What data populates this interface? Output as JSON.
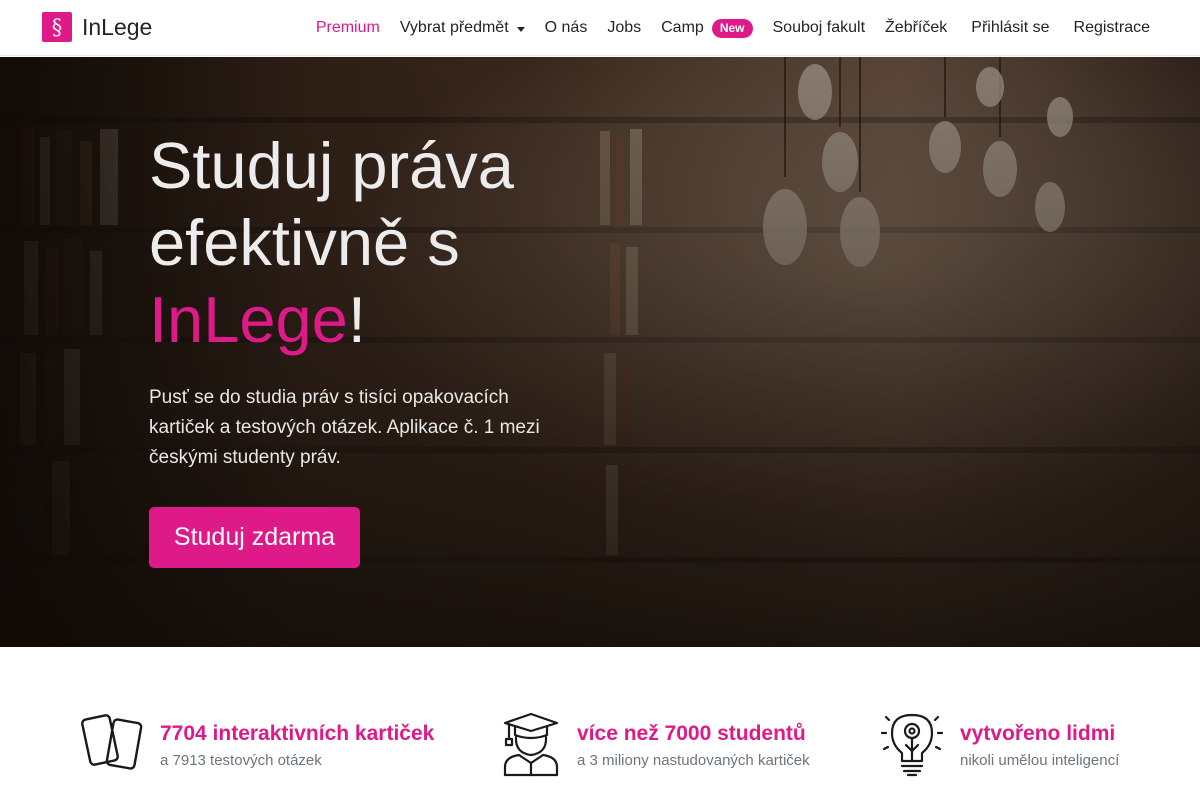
{
  "brand": {
    "logo_glyph": "§",
    "name": "InLege",
    "color": "#dd1a87"
  },
  "nav": {
    "premium": "Premium",
    "subject": "Vybrat předmět",
    "about": "O nás",
    "jobs": "Jobs",
    "camp": "Camp",
    "camp_badge": "New",
    "battle": "Souboj fakult",
    "ranking": "Žebříček",
    "login": "Přihlásit se",
    "register": "Registrace"
  },
  "hero": {
    "title_line1": "Studuj práva",
    "title_line2": "efektivně s",
    "title_brand": "InLege",
    "title_end": "!",
    "text": "Pusť se do studia práv s tisíci opakovacích kartiček a testových otázek. Aplikace č. 1 mezi českými studenty práv.",
    "cta": "Studuj zdarma",
    "background": "library-bookshelves-image"
  },
  "features": [
    {
      "icon": "flashcards-icon",
      "title": "7704 interaktivních kartiček",
      "sub": "a 7913 testových otázek"
    },
    {
      "icon": "graduate-icon",
      "title": "více než 7000 studentů",
      "sub": "a 3 miliony nastudovaných kartiček"
    },
    {
      "icon": "lightbulb-icon",
      "title": "vytvořeno lidmi",
      "sub": "nikoli umělou inteligencí"
    }
  ]
}
